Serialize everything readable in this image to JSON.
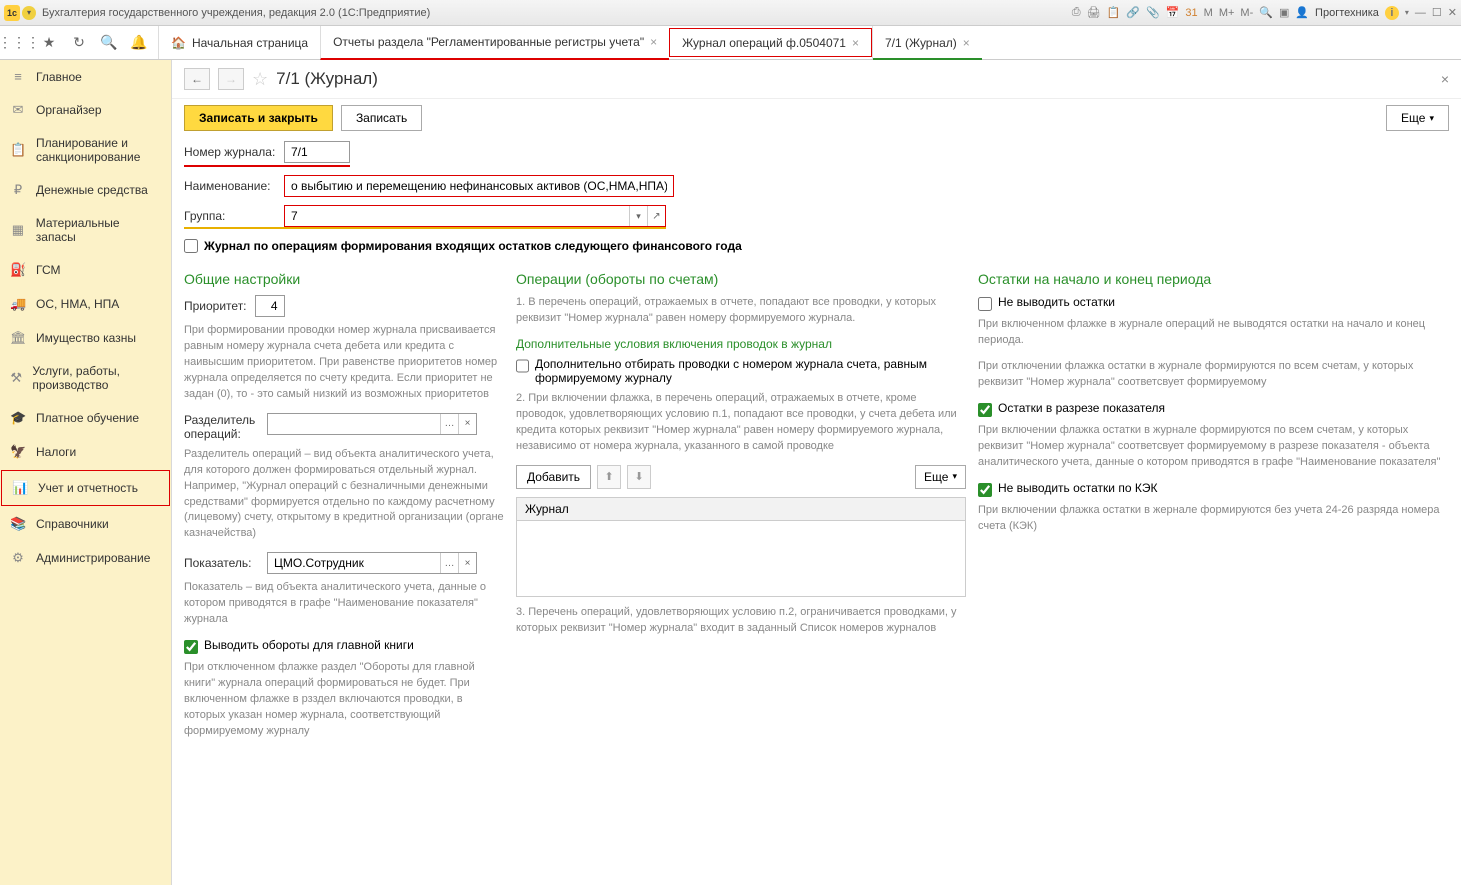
{
  "titlebar": {
    "app_title": "Бухгалтерия государственного учреждения, редакция 2.0  (1С:Предприятие)",
    "m_minus": "M-",
    "m_plus": "M+",
    "m": "M",
    "user": "Прогтехника"
  },
  "tabs": {
    "home": "Начальная страница",
    "t1": "Отчеты раздела \"Регламентированные регистры учета\"",
    "t2": "Журнал операций ф.0504071",
    "t3": "7/1 (Журнал)"
  },
  "sidebar": {
    "items": [
      "Главное",
      "Органайзер",
      "Планирование и санкционирование",
      "Денежные средства",
      "Материальные запасы",
      "ГСМ",
      "ОС, НМА, НПА",
      "Имущество казны",
      "Услуги, работы, производство",
      "Платное обучение",
      "Налоги",
      "Учет и отчетность",
      "Справочники",
      "Администрирование"
    ]
  },
  "page": {
    "title": "7/1 (Журнал)",
    "save_close": "Записать и закрыть",
    "save": "Записать",
    "more": "Еще"
  },
  "form": {
    "journal_lbl": "Номер журнала:",
    "journal_val": "7/1",
    "name_lbl": "Наименование:",
    "name_val": "о выбытию и перемещению нефинансовых активов (ОС,НМА,НПА)",
    "group_lbl": "Группа:",
    "group_val": "7",
    "check1": "Журнал по операциям формирования входящих остатков следующего финансового года"
  },
  "settings": {
    "title": "Общие настройки",
    "priority_lbl": "Приоритет:",
    "priority_val": "4",
    "priority_help": "При формировании проводки номер журнала присваивается равным номеру журнала счета дебета или кредита с наивысшим приоритетом. При равенстве приоритетов номер журнала определяется по счету кредита. Если приоритет не задан (0), то - это самый низкий из возможных приоритетов",
    "sep_lbl": "Разделитель операций:",
    "sep_help": "Разделитель операций – вид объекта аналитического учета, для которого должен формироваться отдельный журнал. Например, \"Журнал операций с безналичными денежными средствами\" формируется отдельно по каждому расчетному (лицевому) счету, открытому в кредитной организации (органе казначейства)",
    "indicator_lbl": "Показатель:",
    "indicator_val": "ЦМО.Сотрудник",
    "indicator_help": "Показатель – вид объекта аналитического учета, данные о котором приводятся в графе \"Наименование показателя\" журнала",
    "gb_cb": "Выводить обороты для главной книги",
    "gb_help": "При отключенном флажке раздел \"Обороты для главной книги\"  журнала операций формироваться не будет. При включенном флажке в рзздел включаются проводки, в которых указан номер журнала, соответствующий формируемому журналу"
  },
  "ops": {
    "title": "Операции (обороты по счетам)",
    "p1": "1. В перечень операций, отражаемых в отчете, попадают все проводки, у которых реквизит \"Номер журнала\" равен номеру формируемого журнала.",
    "subtitle": "Дополнительные условия включения проводок в журнал",
    "cb1": "Дополнительно отбирать проводки с номером журнала счета, равным формируемому журналу",
    "p2": "2. При включении флажка, в перечень операций, отражаемых в отчете, кроме проводок, удовлетворяющих условию п.1, попадают все проводки, у счета дебета или кредита которых реквизит \"Номер журнала\" равен номеру формируемого журнала, независимо от номера журнала, указанного в самой проводке",
    "add": "Добавить",
    "more": "Еще",
    "th": "Журнал",
    "p3": "3. Перечень операций, удовлетворяющих условию п.2, ограничивается проводками, у которых реквизит \"Номер журнала\" входит в заданный Список номеров журналов"
  },
  "balances": {
    "title": "Остатки на начало и конец периода",
    "cb1": "Не выводить остатки",
    "h1": "При включенном флажке в журнале операций не выводятся остатки на начало и конец периода.",
    "h2": "При отключении флажка остатки в журнале формируются по всем счетам, у которых реквизит \"Номер журнала\" соответсвует формируемому",
    "cb2": "Остатки в разрезе показателя",
    "h3": "При включении флажка остатки в журнале формируются по всем счетам, у которых реквизит \"Номер журнала\" соответсвует формируемому в разрезе показателя - объекта аналитического учета, данные о котором приводятся в графе \"Наименование показателя\"",
    "cb3": "Не выводить остатки по КЭК",
    "h4": "При включении флажка остатки в жернале формируются без учета 24-26 разряда номера счета (КЭК)"
  }
}
